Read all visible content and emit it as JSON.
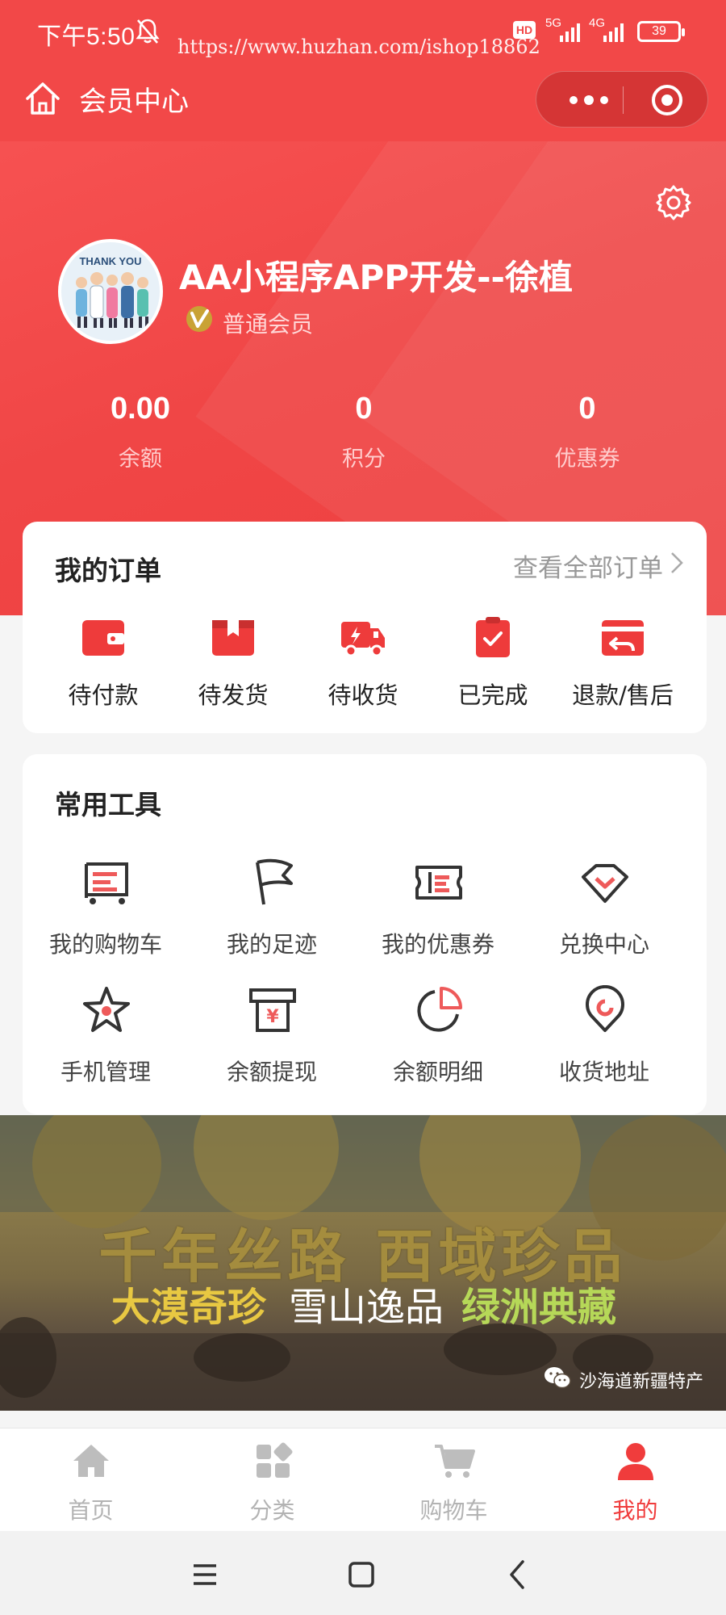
{
  "status_bar": {
    "time": "下午5:50",
    "watermark": "https://www.huzhan.com/ishop18862",
    "hd": "HD",
    "net1": "5G",
    "net2": "4G",
    "battery": "39"
  },
  "nav": {
    "title": "会员中心"
  },
  "profile": {
    "username": "AA小程序APP开发--徐植",
    "member_level": "普通会员",
    "avatar_text": "THANK YOU"
  },
  "stats": [
    {
      "value": "0.00",
      "label": "余额"
    },
    {
      "value": "0",
      "label": "积分"
    },
    {
      "value": "0",
      "label": "优惠券"
    }
  ],
  "orders": {
    "title": "我的订单",
    "view_all": "查看全部订单",
    "items": [
      {
        "label": "待付款",
        "icon": "wallet-icon"
      },
      {
        "label": "待发货",
        "icon": "box-icon"
      },
      {
        "label": "待收货",
        "icon": "truck-icon"
      },
      {
        "label": "已完成",
        "icon": "clipboard-check-icon"
      },
      {
        "label": "退款/售后",
        "icon": "refund-icon"
      }
    ]
  },
  "tools": {
    "title": "常用工具",
    "items": [
      {
        "label": "我的购物车",
        "icon": "cart-icon"
      },
      {
        "label": "我的足迹",
        "icon": "flag-icon"
      },
      {
        "label": "我的优惠券",
        "icon": "ticket-icon"
      },
      {
        "label": "兑换中心",
        "icon": "diamond-icon"
      },
      {
        "label": "手机管理",
        "icon": "star-icon"
      },
      {
        "label": "余额提现",
        "icon": "withdraw-icon"
      },
      {
        "label": "余额明细",
        "icon": "pie-icon"
      },
      {
        "label": "收货地址",
        "icon": "location-icon"
      }
    ]
  },
  "banner": {
    "line1": "千年丝路  西域珍品",
    "line2_a": "大漠奇珍",
    "line2_b": "雪山逸品",
    "line2_c": "绿洲典藏",
    "brand": "沙海道新疆特产"
  },
  "tabbar": {
    "items": [
      {
        "label": "首页",
        "icon": "home-icon",
        "active": false
      },
      {
        "label": "分类",
        "icon": "category-icon",
        "active": false
      },
      {
        "label": "购物车",
        "icon": "cart-icon",
        "active": false
      },
      {
        "label": "我的",
        "icon": "user-icon",
        "active": true
      }
    ]
  },
  "colors": {
    "brand_red": "#f24848",
    "icon_red": "#ee3b3b",
    "tab_active": "#f03c3c",
    "tab_inactive": "#b3b3b3"
  }
}
